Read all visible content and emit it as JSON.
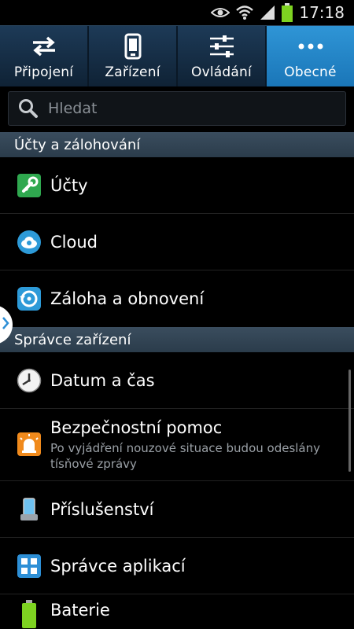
{
  "status_bar": {
    "time": "17:18"
  },
  "tabs": [
    {
      "label": "Připojení",
      "icon": "swap-arrows-icon",
      "active": false
    },
    {
      "label": "Zařízení",
      "icon": "phone-icon",
      "active": false
    },
    {
      "label": "Ovládání",
      "icon": "sliders-icon",
      "active": false
    },
    {
      "label": "Obecné",
      "icon": "more-dots-icon",
      "active": true
    }
  ],
  "search": {
    "placeholder": "Hledat"
  },
  "sections": [
    {
      "header": "Účty a zálohování"
    },
    {
      "header": "Správce zařízení"
    }
  ],
  "items": [
    {
      "title": "Účty",
      "icon": "accounts-key-icon"
    },
    {
      "title": "Cloud",
      "icon": "cloud-icon"
    },
    {
      "title": "Záloha a obnovení",
      "icon": "backup-restore-icon"
    },
    {
      "title": "Datum a čas",
      "icon": "clock-icon"
    },
    {
      "title": "Bezpečnostní pomoc",
      "subtitle": "Po vyjádření nouzové situace budou odeslány tísňové zprávy",
      "icon": "emergency-siren-icon"
    },
    {
      "title": "Příslušenství",
      "icon": "accessory-dock-icon"
    },
    {
      "title": "Správce aplikací",
      "icon": "app-grid-icon"
    },
    {
      "title": "Baterie",
      "icon": "battery-icon"
    }
  ],
  "colors": {
    "tab_active": "#2388cc",
    "tab_bg": "#1a3450",
    "section_bg": "#33475a",
    "battery_green": "#7ed321"
  }
}
